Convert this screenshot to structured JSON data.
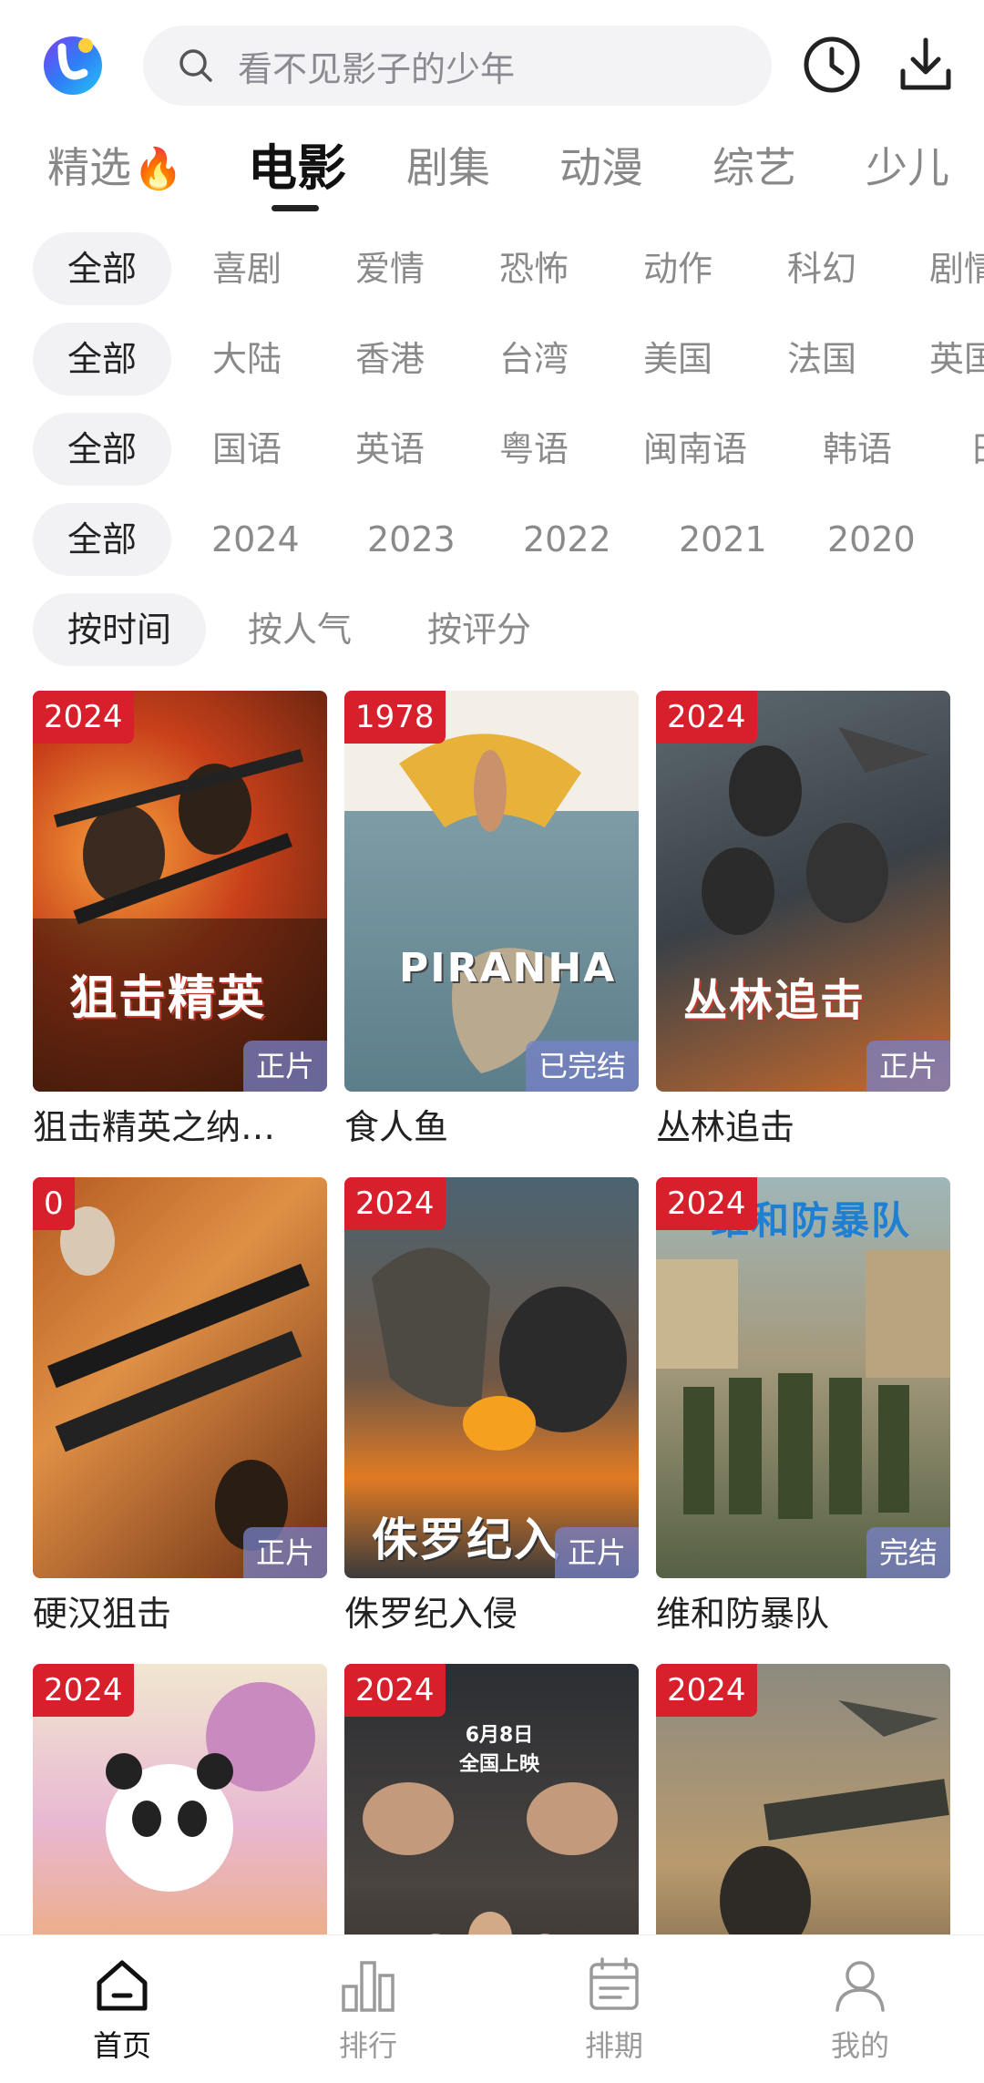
{
  "header": {
    "search_placeholder": "看不见影子的少年",
    "logo_icon": "app-logo",
    "history_icon": "clock-icon",
    "download_icon": "download-icon"
  },
  "tabs": [
    {
      "label": "精选",
      "badge": "🔥"
    },
    {
      "label": "电影",
      "active": true
    },
    {
      "label": "剧集"
    },
    {
      "label": "动漫"
    },
    {
      "label": "综艺"
    },
    {
      "label": "少儿"
    }
  ],
  "filters": {
    "genre": [
      "全部",
      "喜剧",
      "爱情",
      "恐怖",
      "动作",
      "科幻",
      "剧情"
    ],
    "region": [
      "全部",
      "大陆",
      "香港",
      "台湾",
      "美国",
      "法国",
      "英国"
    ],
    "language": [
      "全部",
      "国语",
      "英语",
      "粤语",
      "闽南语",
      "韩语",
      "日语"
    ],
    "year": [
      "全部",
      "2024",
      "2023",
      "2022",
      "2021",
      "2020"
    ],
    "sort": [
      "按时间",
      "按人气",
      "按评分"
    ]
  },
  "movies": [
    {
      "title": "狙击精英之纳…",
      "year": "2024",
      "status": "正片",
      "poster_text": "狙击精英"
    },
    {
      "title": "食人鱼",
      "year": "1978",
      "status": "已完结",
      "poster_text": "PIRANHA"
    },
    {
      "title": "丛林追击",
      "year": "2024",
      "status": "正片",
      "poster_text": "丛林追击"
    },
    {
      "title": "硬汉狙击",
      "year": "0",
      "status": "正片",
      "poster_text": ""
    },
    {
      "title": "侏罗纪入侵",
      "year": "2024",
      "status": "正片",
      "poster_text": "侏罗纪入"
    },
    {
      "title": "维和防暴队",
      "year": "2024",
      "status": "完结",
      "poster_text": "维和防暴队"
    },
    {
      "title": "",
      "year": "2024",
      "status": "",
      "poster_text": ""
    },
    {
      "title": "",
      "year": "2024",
      "status": "",
      "poster_text": "6月8日 全国上映"
    },
    {
      "title": "",
      "year": "2024",
      "status": "",
      "poster_text": ""
    }
  ],
  "bottom_nav": [
    {
      "label": "首页",
      "icon": "home-icon",
      "active": true
    },
    {
      "label": "排行",
      "icon": "bar-chart-icon"
    },
    {
      "label": "排期",
      "icon": "calendar-icon"
    },
    {
      "label": "我的",
      "icon": "user-icon"
    }
  ],
  "colors": {
    "accent_red": "#d7202c",
    "status_badge": "#7882c8",
    "search_bg": "#f3f3f5"
  }
}
